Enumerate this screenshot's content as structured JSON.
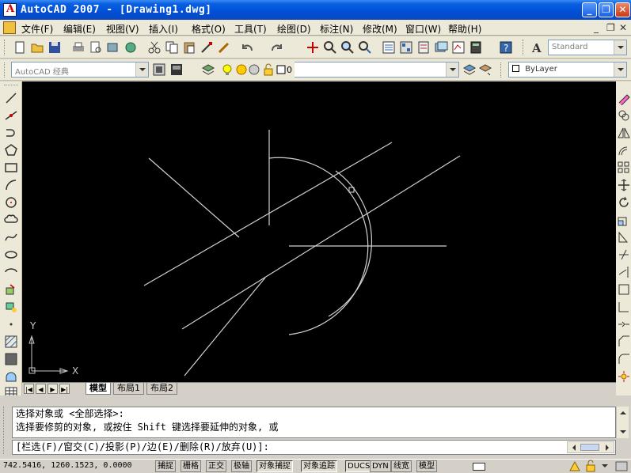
{
  "window": {
    "title": "AutoCAD 2007 - [Drawing1.dwg]"
  },
  "window_controls": {
    "minimize": "_",
    "restore": "❐",
    "close": "✕"
  },
  "mdi_controls": {
    "minimize": "_",
    "restore": "❐",
    "close": "✕"
  },
  "menu": {
    "items": [
      "文件(F)",
      "编辑(E)",
      "视图(V)",
      "插入(I)",
      "格式(O)",
      "工具(T)",
      "绘图(D)",
      "标注(N)",
      "修改(M)",
      "窗口(W)",
      "帮助(H)"
    ]
  },
  "toolbar": {
    "text_style": "Standard",
    "workspace": "AutoCAD 经典",
    "layer": "0",
    "color": "ByLayer"
  },
  "ucs": {
    "x_label": "X",
    "y_label": "Y"
  },
  "tabs": {
    "model": "模型",
    "layout1": "布局1",
    "layout2": "布局2"
  },
  "nav_buttons": [
    "|◀",
    "◀",
    "▶",
    "▶|"
  ],
  "command": {
    "line1": "选择对象或 <全部选择>:",
    "line2": "选择要修剪的对象, 或按住 Shift 键选择要延伸的对象, 或",
    "prompt": "[栏选(F)/窗交(C)/投影(P)/边(E)/删除(R)/放弃(U)]:"
  },
  "status": {
    "coords": "742.5416,  1260.1523, 0.0000",
    "buttons": [
      "捕捉",
      "栅格",
      "正交",
      "极轴",
      "对象捕捉",
      "对象追踪",
      "DUCS",
      "DYN",
      "线宽",
      "模型"
    ]
  },
  "colors": {
    "canvas": "#000000",
    "geometry": "#ffffff",
    "title_bar": "#0a5fe0"
  }
}
